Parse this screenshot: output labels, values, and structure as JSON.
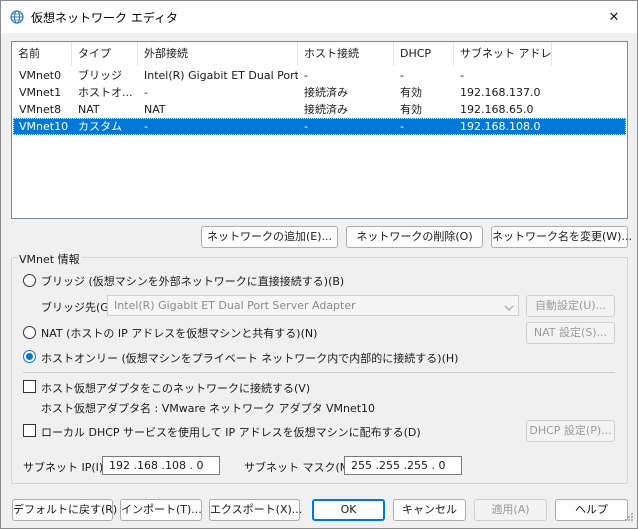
{
  "window": {
    "title": "仮想ネットワーク エディタ",
    "close_glyph": "✕"
  },
  "list": {
    "columns": [
      "名前",
      "タイプ",
      "外部接続",
      "ホスト接続",
      "DHCP",
      "サブネット アドレス"
    ],
    "rows": [
      [
        "VMnet0",
        "ブリッジ",
        "Intel(R) Gigabit ET Dual Port...",
        "-",
        "-",
        "-"
      ],
      [
        "VMnet1",
        "ホストオ...",
        "-",
        "接続済み",
        "有効",
        "192.168.137.0"
      ],
      [
        "VMnet8",
        "NAT",
        "NAT",
        "接続済み",
        "有効",
        "192.168.65.0"
      ],
      [
        "VMnet10",
        "カスタム",
        "-",
        "-",
        "-",
        "192.168.108.0"
      ]
    ]
  },
  "list_buttons": {
    "add": "ネットワークの追加(E)...",
    "remove": "ネットワークの削除(O)",
    "rename": "ネットワーク名を変更(W)..."
  },
  "vmnet_info": {
    "title": "VMnet 情報",
    "bridge_label": "ブリッジ (仮想マシンを外部ネットワークに直接接続する)(B)",
    "bridge_to_label": "ブリッジ先(G):",
    "bridge_to_value": "Intel(R) Gigabit ET Dual Port Server Adapter",
    "auto_settings": "自動設定(U)...",
    "nat_label": "NAT (ホストの IP アドレスを仮想マシンと共有する)(N)",
    "nat_settings": "NAT 設定(S)...",
    "hostonly_label": "ホストオンリー (仮想マシンをプライベート ネットワーク内で内部的に接続する)(H)",
    "host_adapter_label": "ホスト仮想アダプタをこのネットワークに接続する(V)",
    "host_adapter_name": "ホスト仮想アダプタ名 : VMware ネットワーク アダプタ VMnet10",
    "dhcp_label": "ローカル DHCP サービスを使用して IP アドレスを仮想マシンに配布する(D)",
    "dhcp_settings": "DHCP 設定(P)...",
    "subnet_ip_label": "サブネット IP(I):",
    "subnet_ip_value": "192 .168 .108 .  0",
    "subnet_mask_label": "サブネット マスク(M):",
    "subnet_mask_value": "255 .255 .255 .  0"
  },
  "footer": {
    "restore_defaults": "デフォルトに戻す(R)",
    "import": "インポート(T)...",
    "export": "エクスポート(X)...",
    "ok": "OK",
    "cancel": "キャンセル",
    "apply": "適用(A)",
    "help": "ヘルプ"
  },
  "colors": {
    "accent": "#0078d7",
    "selection_bg": "#0078d7"
  }
}
